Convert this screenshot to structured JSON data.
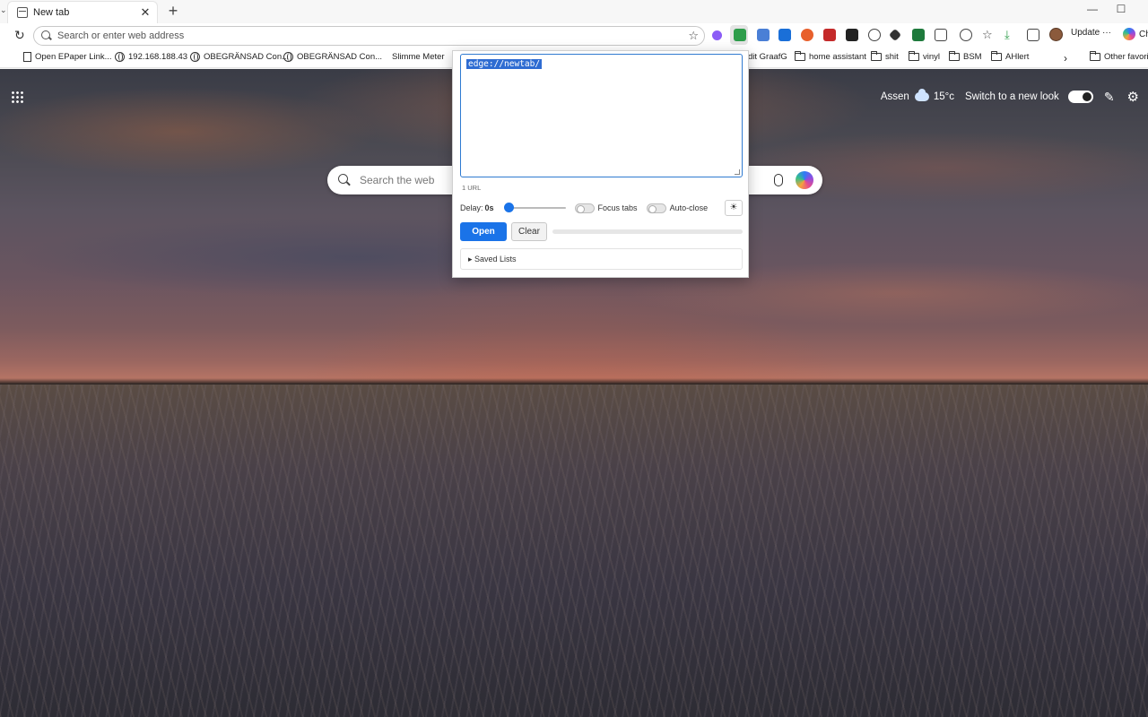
{
  "browser": {
    "tab_title": "New tab",
    "address_placeholder": "Search or enter web address",
    "update_label": "Update ···",
    "copilot_label": "Ch"
  },
  "favorites": [
    {
      "label": "Open EPaper Link...",
      "icon": "document-icon"
    },
    {
      "label": "192.168.188.43",
      "icon": "globe-icon"
    },
    {
      "label": "OBEGRÄNSAD Con...",
      "icon": "globe-icon"
    },
    {
      "label": "OBEGRÄNSAD Con...",
      "icon": "globe-icon"
    },
    {
      "label": "Slimme Meter",
      "icon": "none"
    },
    {
      "label": "dit GraafG",
      "icon": "none"
    },
    {
      "label": "home assistant",
      "icon": "folder-icon"
    },
    {
      "label": "shit",
      "icon": "folder-icon"
    },
    {
      "label": "vinyl",
      "icon": "folder-icon"
    },
    {
      "label": "BSM",
      "icon": "folder-icon"
    },
    {
      "label": "AHlert",
      "icon": "folder-icon"
    },
    {
      "label": "Other favorite",
      "icon": "folder-icon"
    }
  ],
  "ntp": {
    "location": "Assen",
    "temperature": "15°c",
    "switch_label": "Switch to a new look",
    "search_placeholder": "Search the web"
  },
  "popup": {
    "textarea_value": "edge://newtab/",
    "url_count": "1 URL",
    "delay_label": "Delay:",
    "delay_value": "0s",
    "delay_fraction": 0,
    "focus_tabs_label": "Focus tabs",
    "focus_tabs_on": false,
    "auto_close_label": "Auto-close",
    "auto_close_on": false,
    "theme_icon": "☀",
    "open_label": "Open",
    "clear_label": "Clear",
    "progress": 0,
    "saved_lists_label": "▸ Saved Lists"
  },
  "colors": {
    "accent": "#1a73e8",
    "selection": "#2e6cd2"
  }
}
